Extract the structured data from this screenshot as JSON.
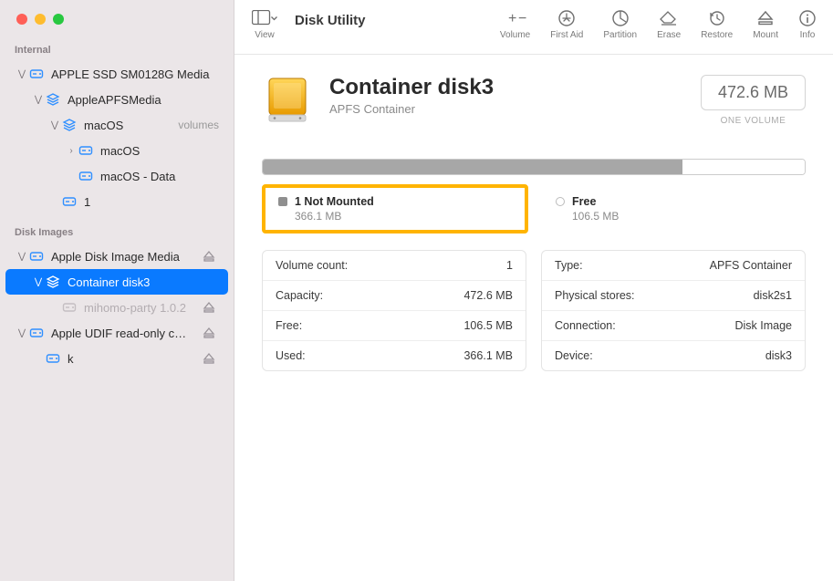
{
  "app_title": "Disk Utility",
  "toolbar": {
    "view": "View",
    "items": [
      {
        "id": "volume",
        "label": "Volume"
      },
      {
        "id": "firstaid",
        "label": "First Aid"
      },
      {
        "id": "partition",
        "label": "Partition"
      },
      {
        "id": "erase",
        "label": "Erase"
      },
      {
        "id": "restore",
        "label": "Restore"
      },
      {
        "id": "mount",
        "label": "Mount"
      },
      {
        "id": "info",
        "label": "Info"
      }
    ]
  },
  "sidebar": {
    "sections": [
      {
        "title": "Internal",
        "tree": [
          {
            "indent": 0,
            "disclosure": "down",
            "icon": "hdd",
            "label": "APPLE SSD SM0128G Media"
          },
          {
            "indent": 1,
            "disclosure": "down",
            "icon": "layers",
            "label": "AppleAPFSMedia"
          },
          {
            "indent": 2,
            "disclosure": "down",
            "icon": "layers",
            "label": "macOS",
            "sublabel": "volumes"
          },
          {
            "indent": 3,
            "disclosure": "right",
            "icon": "hdd",
            "label": "macOS"
          },
          {
            "indent": 3,
            "disclosure": "",
            "icon": "hdd",
            "label": "macOS - Data"
          },
          {
            "indent": 2,
            "disclosure": "",
            "icon": "hdd",
            "label": "1"
          }
        ]
      },
      {
        "title": "Disk Images",
        "tree": [
          {
            "indent": 0,
            "disclosure": "down",
            "icon": "hdd",
            "label": "Apple Disk Image Media",
            "eject": true
          },
          {
            "indent": 1,
            "disclosure": "down",
            "icon": "layers",
            "label": "Container disk3",
            "selected": true
          },
          {
            "indent": 2,
            "disclosure": "",
            "icon": "hdd-dim",
            "label": "mihomo-party 1.0.2",
            "eject": true,
            "dim": true
          },
          {
            "indent": 0,
            "disclosure": "down",
            "icon": "hdd",
            "label": "Apple UDIF read-only c…",
            "eject": true
          },
          {
            "indent": 1,
            "disclosure": "",
            "icon": "hdd",
            "label": "k",
            "eject": true
          }
        ]
      }
    ]
  },
  "disk": {
    "name": "Container disk3",
    "subtitle": "APFS Container",
    "capacity_badge": "472.6 MB",
    "capacity_label": "ONE VOLUME"
  },
  "usage": {
    "used_pct": 77.5,
    "segments": [
      {
        "title": "1 Not Mounted",
        "value": "366.1 MB",
        "kind": "used",
        "highlighted": true
      },
      {
        "title": "Free",
        "value": "106.5 MB",
        "kind": "free",
        "highlighted": false
      }
    ]
  },
  "info": {
    "left": [
      {
        "key": "Volume count:",
        "val": "1"
      },
      {
        "key": "Capacity:",
        "val": "472.6 MB"
      },
      {
        "key": "Free:",
        "val": "106.5 MB"
      },
      {
        "key": "Used:",
        "val": "366.1 MB"
      }
    ],
    "right": [
      {
        "key": "Type:",
        "val": "APFS Container"
      },
      {
        "key": "Physical stores:",
        "val": "disk2s1"
      },
      {
        "key": "Connection:",
        "val": "Disk Image"
      },
      {
        "key": "Device:",
        "val": "disk3"
      }
    ]
  },
  "chart_data": {
    "type": "bar",
    "title": "Container disk3 usage",
    "categories": [
      "Used (Not Mounted)",
      "Free"
    ],
    "values": [
      366.1,
      106.5
    ],
    "unit": "MB",
    "total": 472.6
  }
}
